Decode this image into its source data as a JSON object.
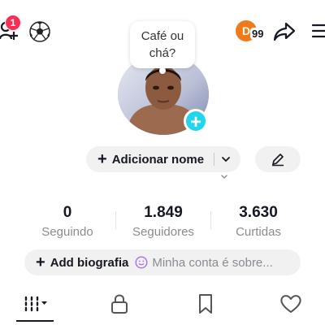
{
  "header": {
    "notification_count": "1",
    "creator_initial": "D",
    "creator_number": "99",
    "icons": [
      "add-friend-icon",
      "soccer-ball-icon",
      "share-icon",
      "menu-icon"
    ]
  },
  "profile": {
    "bubble_text": "Café ou chá?",
    "add_name_label": "Adicionar nome",
    "colors": {
      "accent": "#20d5ec",
      "badge": "#fe2c55",
      "creator": "#f07a19"
    }
  },
  "stats": [
    {
      "value": "0",
      "label": "Seguindo"
    },
    {
      "value": "1.849",
      "label": "Seguidores"
    },
    {
      "value": "3.630",
      "label": "Curtidas"
    }
  ],
  "bio": {
    "add_label": "Add biografia",
    "placeholder": "Minha conta é sobre..."
  },
  "tabs": [
    {
      "name": "videos-grid",
      "icon": "grid-icon",
      "selected": true
    },
    {
      "name": "private",
      "icon": "lock-icon",
      "selected": false
    },
    {
      "name": "saved",
      "icon": "bookmark-icon",
      "selected": false
    },
    {
      "name": "liked",
      "icon": "heart-icon",
      "selected": false
    }
  ]
}
